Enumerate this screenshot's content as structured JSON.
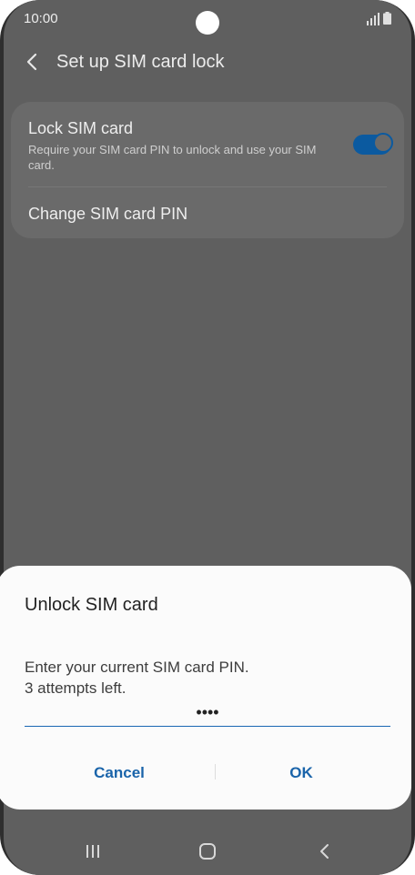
{
  "status_bar": {
    "time": "10:00"
  },
  "app_bar": {
    "title": "Set up SIM card lock"
  },
  "settings": {
    "lock_sim": {
      "title": "Lock SIM card",
      "subtitle": "Require your SIM card PIN to unlock and use your SIM card.",
      "enabled": true
    },
    "change_pin": {
      "title": "Change SIM card PIN"
    }
  },
  "dialog": {
    "title": "Unlock SIM card",
    "message_line1": "Enter your current SIM card PIN.",
    "message_line2": "3 attempts left.",
    "pin_value": "••••",
    "cancel_label": "Cancel",
    "ok_label": "OK"
  },
  "colors": {
    "accent": "#1a64aa",
    "overlay": "#5f5f5f",
    "dialog_bg": "#fbfbfb"
  },
  "icons": {
    "back": "chevron-left-icon",
    "nav_recent": "recent-apps-icon",
    "nav_home": "home-icon",
    "nav_back": "nav-back-icon"
  }
}
